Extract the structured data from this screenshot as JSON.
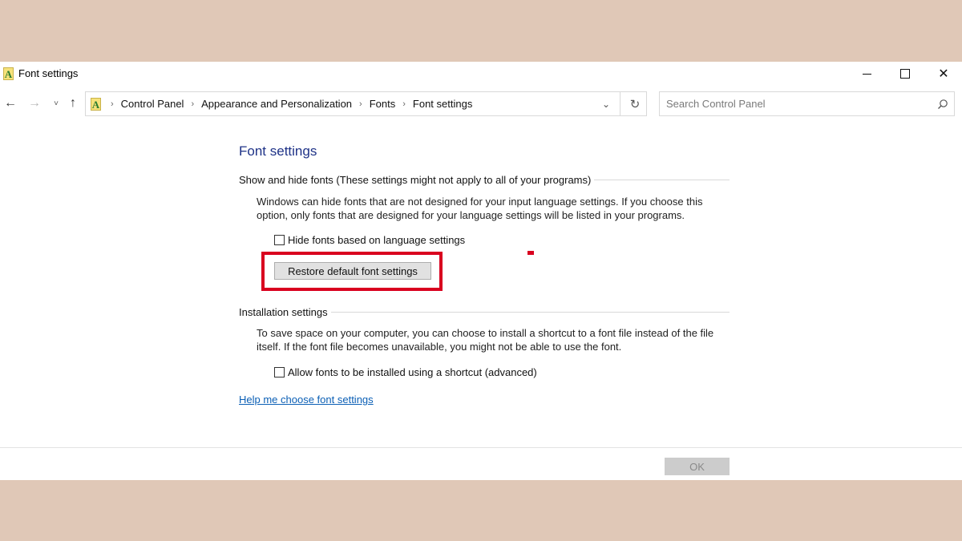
{
  "window": {
    "title": "Font settings",
    "app_icon_glyph": "A",
    "icon": "fonts-folder-icon"
  },
  "titlebar": {
    "minimize_icon": "minimize-icon",
    "maximize_icon": "maximize-icon",
    "close_icon": "close-icon",
    "close_glyph": "✕"
  },
  "nav": {
    "back_glyph": "←",
    "forward_glyph": "→",
    "recent_glyph": "˅",
    "up_glyph": "↑"
  },
  "address": {
    "icon_glyph": "A",
    "breadcrumbs": [
      "Control Panel",
      "Appearance and Personalization",
      "Fonts",
      "Font settings"
    ],
    "separator": "›",
    "dropdown_glyph": "⌄",
    "refresh_glyph": "↻"
  },
  "search": {
    "placeholder": "Search Control Panel",
    "value": ""
  },
  "content": {
    "page_title": "Font settings",
    "show_hide": {
      "heading": "Show and hide fonts (These settings might not apply to all of your programs)",
      "description": "Windows can hide fonts that are not designed for your input language settings. If you choose this option, only fonts that are designed for your language settings will be listed in your programs.",
      "checkbox_label": "Hide fonts based on language settings",
      "checkbox_checked": false,
      "restore_button": "Restore default font settings"
    },
    "installation": {
      "heading": "Installation settings",
      "description": "To save space on your computer, you can choose to install a shortcut to a font file instead of the file itself. If the font file becomes unavailable, you might not be able to use the font.",
      "checkbox_label": "Allow fonts to be installed using a shortcut (advanced)",
      "checkbox_checked": false
    },
    "help_link": "Help me choose font settings"
  },
  "footer": {
    "ok_button": "OK",
    "ok_enabled": false
  },
  "colors": {
    "background": "#e0c8b7",
    "title_blue": "#1e3287",
    "link_blue": "#0b5fb5",
    "highlight_red": "#d9001f"
  }
}
